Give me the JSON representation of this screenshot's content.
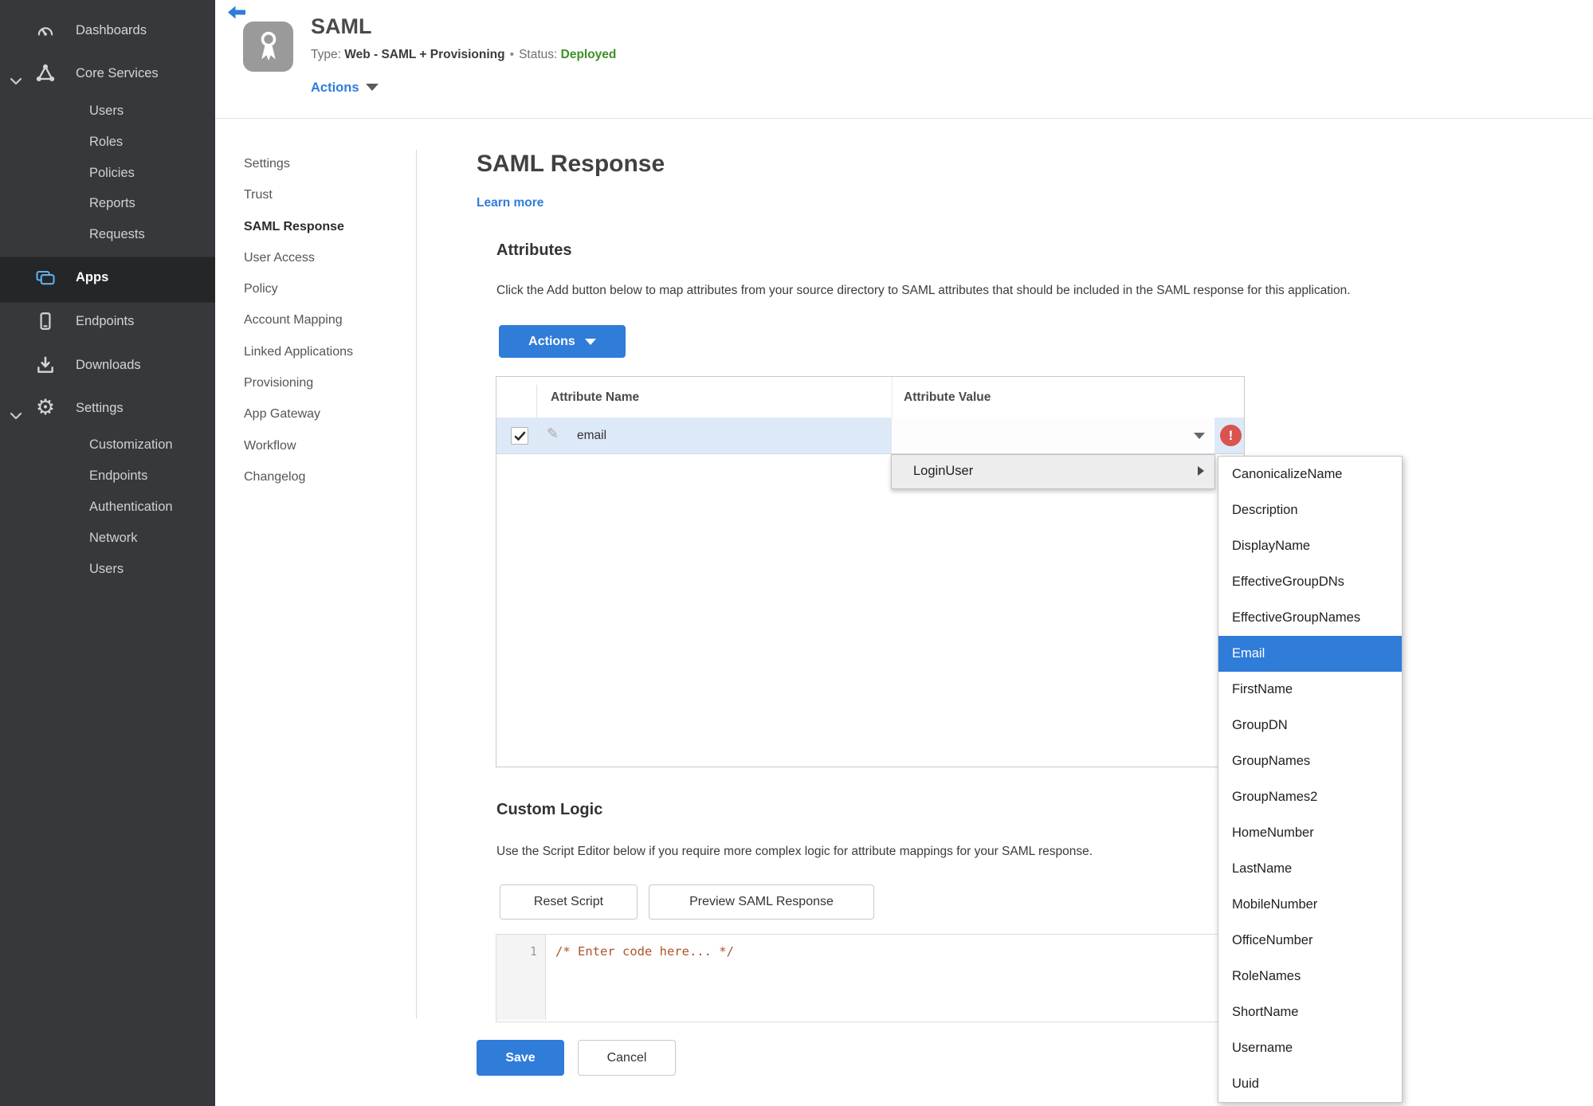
{
  "colors": {
    "accent_blue": "#2f7cd9",
    "status_green": "#3f8f29",
    "error_red": "#d9534f",
    "row_highlight_blue": "#dde9f7",
    "sidebar_bg": "#36383c",
    "sidebar_selected_bg": "#242628",
    "code_comment": "#ac5429"
  },
  "sidebar": {
    "items": [
      {
        "label": "Dashboards",
        "icon": "gauge-icon"
      },
      {
        "label": "Core Services",
        "icon": "core-services-icon",
        "expanded": true
      },
      {
        "label": "Users"
      },
      {
        "label": "Roles"
      },
      {
        "label": "Policies"
      },
      {
        "label": "Reports"
      },
      {
        "label": "Requests"
      },
      {
        "label": "Apps",
        "icon": "apps-icon",
        "selected": true
      },
      {
        "label": "Endpoints",
        "icon": "endpoints-icon"
      },
      {
        "label": "Downloads",
        "icon": "download-icon"
      },
      {
        "label": "Settings",
        "icon": "gear-icon",
        "expanded": true
      },
      {
        "label": "Customization"
      },
      {
        "label": "Endpoints"
      },
      {
        "label": "Authentication"
      },
      {
        "label": "Network"
      },
      {
        "label": "Users"
      }
    ]
  },
  "header": {
    "title": "SAML",
    "type_label": "Type:",
    "type_value": "Web - SAML + Provisioning",
    "dot": "•",
    "status_label": "Status:",
    "status_value": "Deployed",
    "actions_label": "Actions"
  },
  "subnav": {
    "active": "SAML Response",
    "items": [
      "Settings",
      "Trust",
      "SAML Response",
      "User Access",
      "Policy",
      "Account Mapping",
      "Linked Applications",
      "Provisioning",
      "App Gateway",
      "Workflow",
      "Changelog"
    ]
  },
  "content": {
    "title": "SAML Response",
    "learn_more": "Learn more",
    "attributes": {
      "heading": "Attributes",
      "description": "Click the Add button below to map attributes from your source directory to SAML attributes that should be included in the SAML response for this application.",
      "actions_button": "Actions",
      "table": {
        "columns": [
          "Attribute Name",
          "Attribute Value"
        ],
        "rows": [
          {
            "name": "email",
            "value": "",
            "checked": true,
            "error": "!"
          }
        ]
      }
    },
    "custom_logic": {
      "heading": "Custom Logic",
      "description": "Use the Script Editor below if you require more complex logic for attribute mappings for your SAML response.",
      "reset_button": "Reset Script",
      "preview_button": "Preview SAML Response",
      "editor": {
        "line_number": "1",
        "code": "/* Enter code here... */"
      }
    },
    "save_button": "Save",
    "cancel_button": "Cancel"
  },
  "dropdown": {
    "parent_item": "LoginUser",
    "selected_item": "Email",
    "items": [
      "CanonicalizeName",
      "Description",
      "DisplayName",
      "EffectiveGroupDNs",
      "EffectiveGroupNames",
      "Email",
      "FirstName",
      "GroupDN",
      "GroupNames",
      "GroupNames2",
      "HomeNumber",
      "LastName",
      "MobileNumber",
      "OfficeNumber",
      "RoleNames",
      "ShortName",
      "Username",
      "Uuid"
    ]
  }
}
